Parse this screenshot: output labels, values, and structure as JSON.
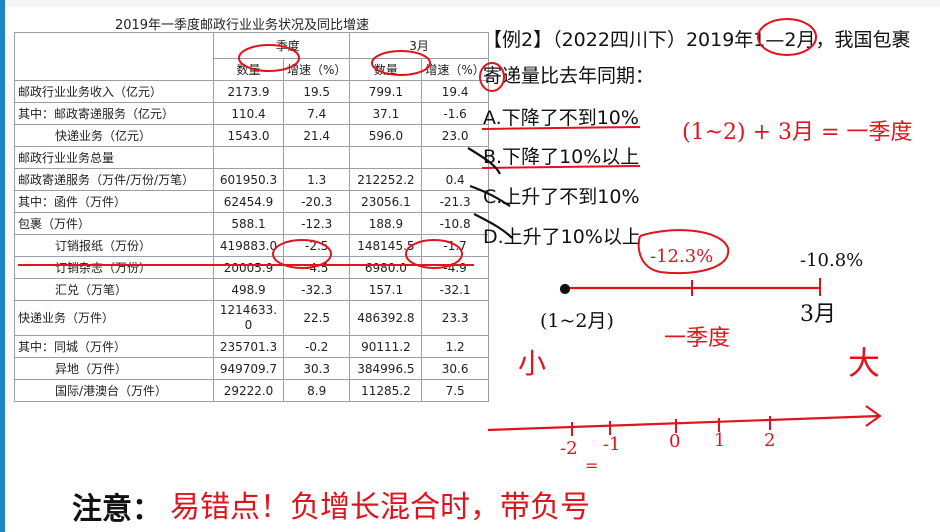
{
  "table": {
    "title": "2019年一季度邮政行业业务状况及同比增速",
    "group_q1": "一季度",
    "group_mar": "3月",
    "col_qty": "数量",
    "col_rate": "增速（%）",
    "rows": [
      {
        "label": "邮政行业业务收入（亿元）",
        "q1": "2173.9",
        "q1r": "19.5",
        "m": "799.1",
        "mr": "19.4"
      },
      {
        "label": "其中：邮政寄递服务（亿元）",
        "q1": "110.4",
        "q1r": "7.4",
        "m": "37.1",
        "mr": "-1.6"
      },
      {
        "label": "快递业务（亿元）",
        "q1": "1543.0",
        "q1r": "21.4",
        "m": "596.0",
        "mr": "23.0"
      },
      {
        "label": "邮政行业业务总量",
        "q1": "",
        "q1r": "",
        "m": "",
        "mr": ""
      },
      {
        "label": "邮政寄递服务（万件/万份/万笔）",
        "q1": "601950.3",
        "q1r": "1.3",
        "m": "212252.2",
        "mr": "0.4"
      },
      {
        "label": "其中：函件（万件）",
        "q1": "62454.9",
        "q1r": "-20.3",
        "m": "23056.1",
        "mr": "-21.3"
      },
      {
        "label": "包裹（万件）",
        "q1": "588.1",
        "q1r": "-12.3",
        "m": "188.9",
        "mr": "-10.8"
      },
      {
        "label": "订销报纸（万份）",
        "q1": "419883.0",
        "q1r": "-2.5",
        "m": "148145.5",
        "mr": "-1.7"
      },
      {
        "label": "订销杂志（万份）",
        "q1": "20005.9",
        "q1r": "-4.5",
        "m": "6980.0",
        "mr": "-4.9"
      },
      {
        "label": "汇兑（万笔）",
        "q1": "498.9",
        "q1r": "-32.3",
        "m": "157.1",
        "mr": "-32.1"
      },
      {
        "label": "快递业务（万件）",
        "q1": "1214633.0",
        "q1r": "22.5",
        "m": "486392.8",
        "mr": "23.3"
      },
      {
        "label": "其中：同城（万件）",
        "q1": "235701.3",
        "q1r": "-0.2",
        "m": "90111.2",
        "mr": "1.2"
      },
      {
        "label": "异地（万件）",
        "q1": "949709.7",
        "q1r": "30.3",
        "m": "384996.5",
        "mr": "30.6"
      },
      {
        "label": "国际/港澳台（万件）",
        "q1": "29222.0",
        "q1r": "8.9",
        "m": "11285.2",
        "mr": "7.5"
      }
    ]
  },
  "question": {
    "stem": "【例2】（2022四川下）2019年1—2月，我国包裹寄递量比去年同期：",
    "options": [
      "A.下降了不到10%",
      "B.下降了10%以上",
      "C.上升了不到10%",
      "D.上升了10%以上"
    ]
  },
  "notes": {
    "formula": "(1~2) + 3月 = 一季度",
    "marker_q1_value": "-12.3%",
    "marker_mar_value": "-10.8%",
    "axis_label_12": "(1~2月)",
    "axis_label_q1": "一季度",
    "axis_label_mar": "3月",
    "small": "小",
    "big": "大",
    "numline_ticks": [
      "-2",
      "-1",
      "0",
      "1",
      "2"
    ],
    "numline_eq": "=",
    "caution_label": "注意：",
    "caution_text": "易错点！负增长混合时，带负号",
    "ink_color": "#e0141e"
  }
}
